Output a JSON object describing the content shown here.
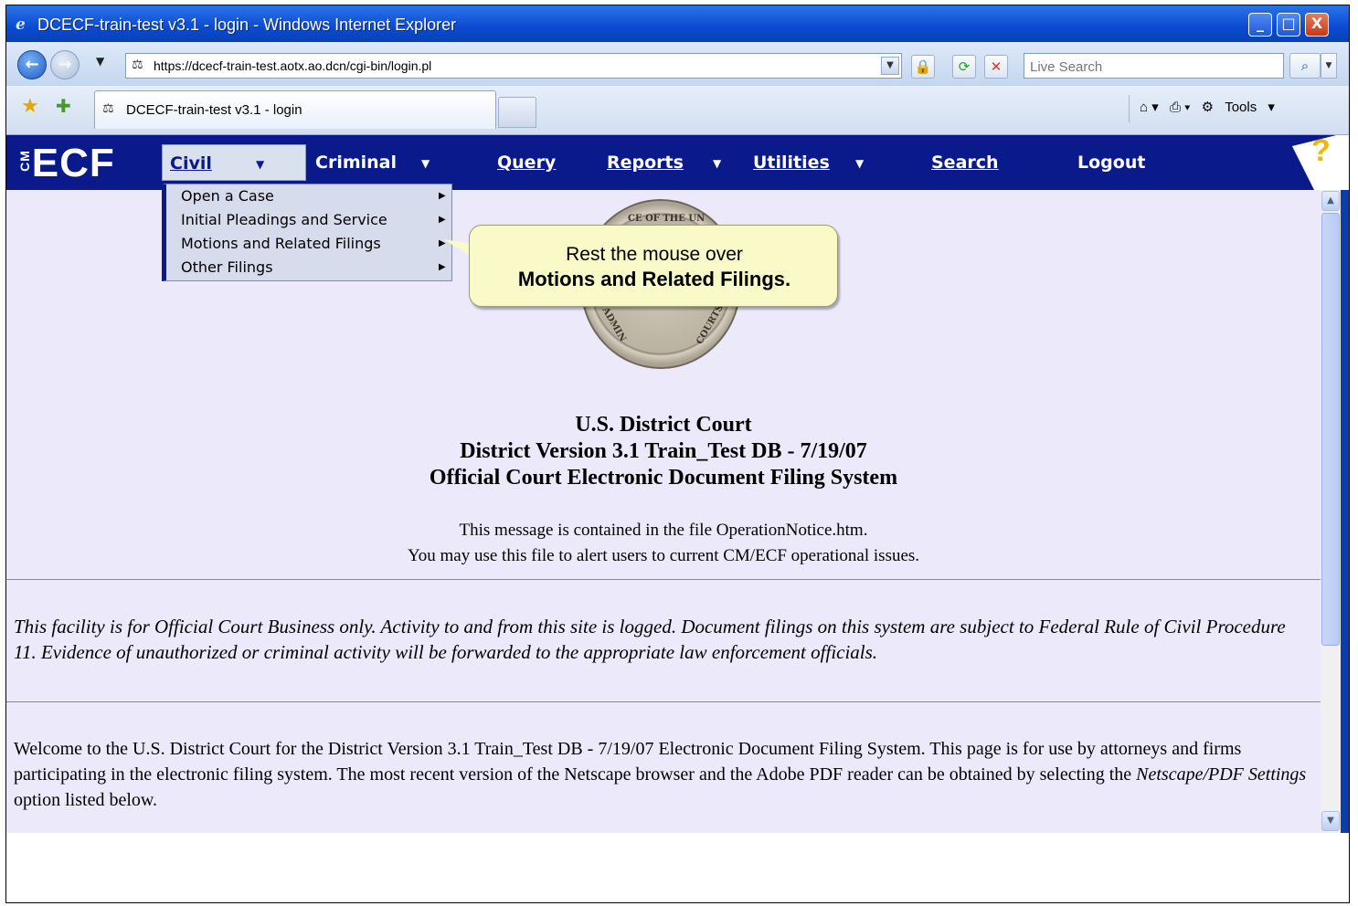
{
  "window": {
    "title": "DCECF-train-test v3.1 - login - Windows Internet Explorer",
    "ie_icon": "ie-logo-icon",
    "controls": {
      "minimize": "_",
      "maximize": "□",
      "close": "X"
    }
  },
  "address": {
    "url": "https://dcecf-train-test.aotx.ao.dcn/cgi-bin/login.pl",
    "search_placeholder": "Live Search"
  },
  "tabs": {
    "active_label": "DCECF-train-test v3.1 - login",
    "tools_label": "Tools"
  },
  "ecf": {
    "logo_prefix": "CM",
    "logo_text": "ECF",
    "menu": [
      {
        "label": "Civil",
        "has_arrow": true
      },
      {
        "label": "Criminal",
        "has_arrow": true
      },
      {
        "label": "Query",
        "has_arrow": false
      },
      {
        "label": "Reports",
        "has_arrow": true
      },
      {
        "label": "Utilities",
        "has_arrow": true
      },
      {
        "label": "Search",
        "has_arrow": false
      },
      {
        "label": "Logout",
        "has_arrow": false
      }
    ],
    "help_symbol": "?"
  },
  "dropdown": {
    "items": [
      "Open a Case",
      "Initial Pleadings and Service",
      "Motions and Related Filings",
      "Other Filings"
    ]
  },
  "callout": {
    "line1": "Rest the mouse over",
    "line2": "Motions and  Related Filings."
  },
  "seal": {
    "top_text": "CE OF THE UN",
    "left_text": "ADMIN",
    "right_text": "COURTS"
  },
  "content": {
    "heading1": "U.S. District Court",
    "heading2": "District Version 3.1 Train_Test DB - 7/19/07",
    "heading3": "Official Court Electronic Document Filing System",
    "message1": "This message is contained in the file OperationNotice.htm.",
    "message2": "You may use this file to alert users to current CM/ECF operational issues.",
    "notice": "This facility is for Official Court Business only. Activity to and from this site is logged. Document filings on this system are subject to Federal Rule of Civil Procedure 11. Evidence of unauthorized or criminal activity will be forwarded to the appropriate law enforcement officials.",
    "welcome_part1": "Welcome to the U.S. District Court for the District Version 3.1 Train_Test DB - 7/19/07 Electronic Document Filing System. This page is for use by attorneys and firms participating in the electronic filing system. The most recent version of the Netscape browser and the Adobe PDF reader can be obtained by selecting the ",
    "welcome_italic": "Netscape/PDF Settings",
    "welcome_part2": " option listed below."
  },
  "colors": {
    "titlebar": "#0a4bd3",
    "menubar": "#0a1a8a",
    "content_bg": "#ebe9fa",
    "callout_bg": "#fafac8"
  }
}
